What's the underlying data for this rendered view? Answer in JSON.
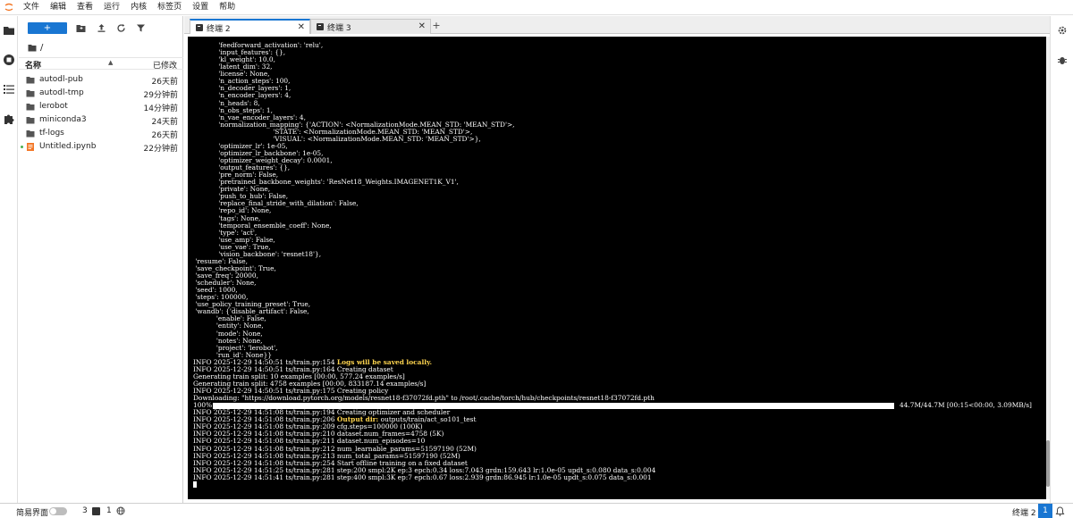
{
  "menubar": {
    "items": [
      "文件",
      "编辑",
      "查看",
      "运行",
      "内核",
      "标签页",
      "设置",
      "帮助"
    ]
  },
  "filebrowser": {
    "new_label": "+",
    "path": "/",
    "header_name": "名称",
    "header_modified": "已修改",
    "items": [
      {
        "name": "autodl-pub",
        "modified": "26天前",
        "type": "folder"
      },
      {
        "name": "autodl-tmp",
        "modified": "29分钟前",
        "type": "folder"
      },
      {
        "name": "lerobot",
        "modified": "14分钟前",
        "type": "folder"
      },
      {
        "name": "miniconda3",
        "modified": "24天前",
        "type": "folder"
      },
      {
        "name": "tf-logs",
        "modified": "26天前",
        "type": "folder"
      },
      {
        "name": "Untitled.ipynb",
        "modified": "22分钟前",
        "type": "notebook"
      }
    ]
  },
  "tabs": [
    {
      "label": "终端 2",
      "active": true
    },
    {
      "label": "终端 3",
      "active": false
    }
  ],
  "tab_add_label": "+",
  "terminal": {
    "lines_before": [
      "            'feedforward_activation': 'relu',",
      "            'input_features': {},",
      "            'kl_weight': 10.0,",
      "            'latent_dim': 32,",
      "            'license': None,",
      "            'n_action_steps': 100,",
      "            'n_decoder_layers': 1,",
      "            'n_encoder_layers': 4,",
      "            'n_heads': 8,",
      "            'n_obs_steps': 1,",
      "            'n_vae_encoder_layers': 4,",
      "            'normalization_mapping': {'ACTION': <NormalizationMode.MEAN_STD: 'MEAN_STD'>,",
      "                                      'STATE': <NormalizationMode.MEAN_STD: 'MEAN_STD'>,",
      "                                      'VISUAL': <NormalizationMode.MEAN_STD: 'MEAN_STD'>},",
      "            'optimizer_lr': 1e-05,",
      "            'optimizer_lr_backbone': 1e-05,",
      "            'optimizer_weight_decay': 0.0001,",
      "            'output_features': {},",
      "            'pre_norm': False,",
      "            'pretrained_backbone_weights': 'ResNet18_Weights.IMAGENET1K_V1',",
      "            'private': None,",
      "            'push_to_hub': False,",
      "            'replace_final_stride_with_dilation': False,",
      "            'repo_id': None,",
      "            'tags': None,",
      "            'temporal_ensemble_coeff': None,",
      "            'type': 'act',",
      "            'use_amp': False,",
      "            'use_vae': True,",
      "            'vision_backbone': 'resnet18'},",
      " 'resume': False,",
      " 'save_checkpoint': True,",
      " 'save_freq': 20000,",
      " 'scheduler': None,",
      " 'seed': 1000,",
      " 'steps': 100000,",
      " 'use_policy_training_preset': True,",
      " 'wandb': {'disable_artifact': False,",
      "           'enable': False,",
      "           'entity': None,",
      "           'mode': None,",
      "           'notes': None,",
      "           'project': 'lerobot',",
      "           'run_id': None}}"
    ],
    "log1_prefix": "INFO 2025-12-29 14:50:51 ts/train.py:154 ",
    "log1_highlight": "Logs will be saved locally.",
    "lines_mid": [
      "INFO 2025-12-29 14:50:51 ts/train.py:164 Creating dataset",
      "Generating train split: 10 examples [00:00, 577.24 examples/s]",
      "Generating train split: 4758 examples [00:00, 833187.14 examples/s]",
      "INFO 2025-12-29 14:50:51 ts/train.py:175 Creating policy",
      "Downloading: \"https://download.pytorch.org/models/resnet18-f37072fd.pth\" to /root/.cache/torch/hub/checkpoints/resnet18-f37072fd.pth"
    ],
    "progress_left": "100%",
    "progress_right": "44.7M/44.7M [00:15<00:00, 3.09MB/s]",
    "progress_fraction": 1.0,
    "log2": "INFO 2025-12-29 14:51:08 ts/train.py:194 Creating optimizer and scheduler",
    "log3_prefix": "INFO 2025-12-29 14:51:08 ts/train.py:206 ",
    "log3_highlight": "Output dir:",
    "log3_suffix": " outputs/train/act_so101_test",
    "lines_after": [
      "INFO 2025-12-29 14:51:08 ts/train.py:209 cfg.steps=100000 (100K)",
      "INFO 2025-12-29 14:51:08 ts/train.py:210 dataset.num_frames=4758 (5K)",
      "INFO 2025-12-29 14:51:08 ts/train.py:211 dataset.num_episodes=10",
      "INFO 2025-12-29 14:51:08 ts/train.py:212 num_learnable_params=51597190 (52M)",
      "INFO 2025-12-29 14:51:08 ts/train.py:213 num_total_params=51597190 (52M)",
      "INFO 2025-12-29 14:51:08 ts/train.py:254 Start offline training on a fixed dataset",
      "INFO 2025-12-29 14:51:25 ts/train.py:281 step:200 smpl:2K ep:3 epch:0.34 loss:7.043 grdn:159.643 lr:1.0e-05 updt_s:0.080 data_s:0.004",
      "INFO 2025-12-29 14:51:41 ts/train.py:281 step:400 smpl:3K ep:7 epch:0.67 loss:2.939 grdn:86.945 lr:1.0e-05 updt_s:0.075 data_s:0.001"
    ]
  },
  "statusbar": {
    "mode_label": "简易界面",
    "count_a": "3",
    "count_b": "1",
    "right_label": "终端 2",
    "badge": "1"
  }
}
